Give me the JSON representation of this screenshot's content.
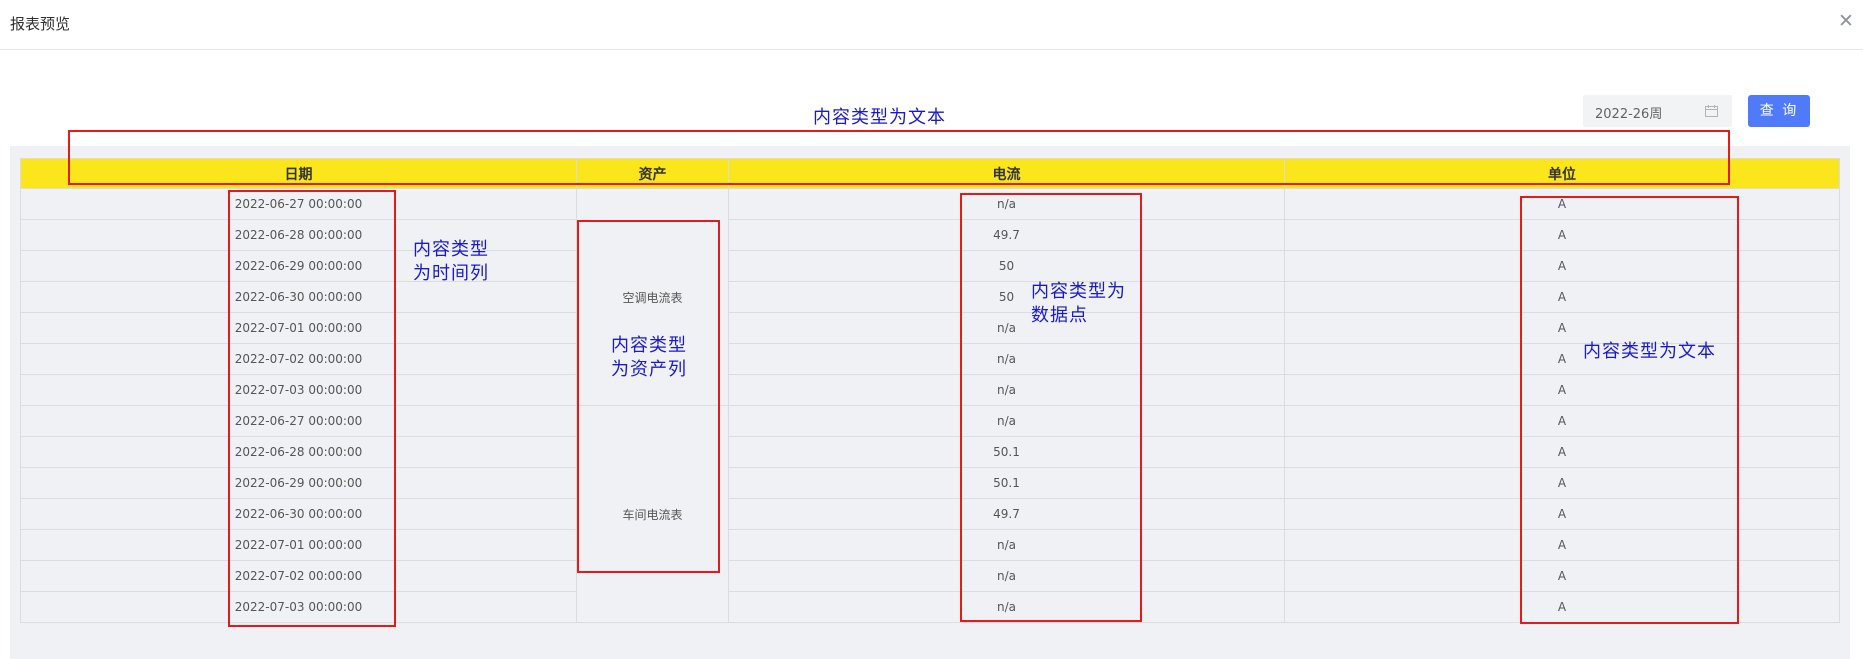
{
  "dialog": {
    "title": "报表预览",
    "close_icon": "close-icon"
  },
  "toolbar": {
    "week_value": "2022-26周",
    "calendar_icon": "calendar-icon",
    "query_label": "查 询"
  },
  "table": {
    "headers": [
      "日期",
      "资产",
      "电流",
      "单位"
    ],
    "assets": [
      "空调电流表",
      "车间电流表"
    ],
    "rows": [
      {
        "date": "2022-06-27 00:00:00",
        "current": "n/a",
        "unit": "A"
      },
      {
        "date": "2022-06-28 00:00:00",
        "current": "49.7",
        "unit": "A"
      },
      {
        "date": "2022-06-29 00:00:00",
        "current": "50",
        "unit": "A"
      },
      {
        "date": "2022-06-30 00:00:00",
        "current": "50",
        "unit": "A"
      },
      {
        "date": "2022-07-01 00:00:00",
        "current": "n/a",
        "unit": "A"
      },
      {
        "date": "2022-07-02 00:00:00",
        "current": "n/a",
        "unit": "A"
      },
      {
        "date": "2022-07-03 00:00:00",
        "current": "n/a",
        "unit": "A"
      },
      {
        "date": "2022-06-27 00:00:00",
        "current": "n/a",
        "unit": "A"
      },
      {
        "date": "2022-06-28 00:00:00",
        "current": "50.1",
        "unit": "A"
      },
      {
        "date": "2022-06-29 00:00:00",
        "current": "50.1",
        "unit": "A"
      },
      {
        "date": "2022-06-30 00:00:00",
        "current": "49.7",
        "unit": "A"
      },
      {
        "date": "2022-07-01 00:00:00",
        "current": "n/a",
        "unit": "A"
      },
      {
        "date": "2022-07-02 00:00:00",
        "current": "n/a",
        "unit": "A"
      },
      {
        "date": "2022-07-03 00:00:00",
        "current": "n/a",
        "unit": "A"
      }
    ]
  },
  "annotations": {
    "header_note": "内容类型为文本",
    "date_note": "内容类型\n为时间列",
    "asset_note": "内容类型\n为资产列",
    "current_note": "内容类型为\n数据点",
    "unit_note": "内容类型为文本"
  },
  "colors": {
    "header_bg": "#fbe51b",
    "button_bg": "#4f7bfb",
    "annotation_box": "#e51b1b",
    "annotation_text": "#1a1ac8"
  }
}
